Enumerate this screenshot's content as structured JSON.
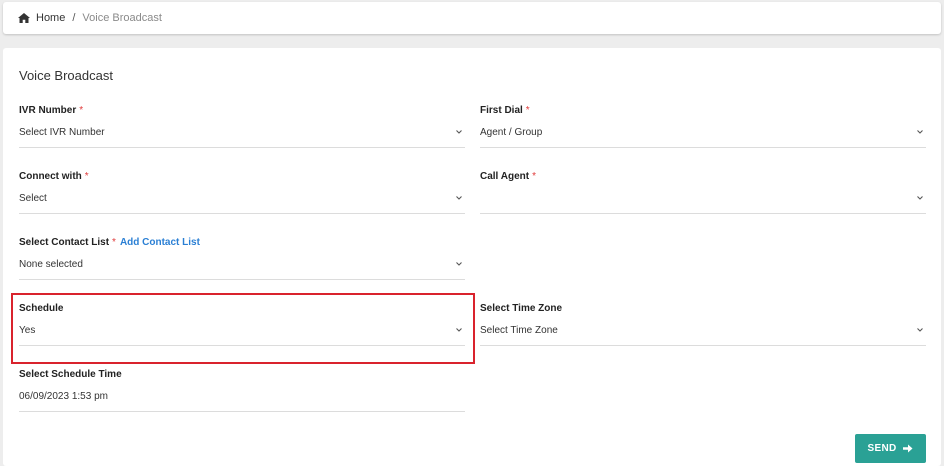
{
  "breadcrumb": {
    "home_label": "Home",
    "separator": "/",
    "current_label": "Voice Broadcast",
    "home_icon": "home-icon"
  },
  "form": {
    "title": "Voice Broadcast",
    "required_marker": "*",
    "ivr_number": {
      "label": "IVR Number",
      "value": "Select IVR Number"
    },
    "first_dial": {
      "label": "First Dial",
      "value": "Agent / Group"
    },
    "connect_with": {
      "label": "Connect with",
      "value": "Select"
    },
    "call_agent": {
      "label": "Call Agent",
      "value": ""
    },
    "contact_list": {
      "label": "Select Contact List",
      "add_link": "Add Contact List",
      "value": "None selected"
    },
    "schedule": {
      "label": "Schedule",
      "value": "Yes"
    },
    "time_zone": {
      "label": "Select Time Zone",
      "value": "Select Time Zone"
    },
    "schedule_time": {
      "label": "Select Schedule Time",
      "value": "06/09/2023 1:53 pm"
    }
  },
  "send_button": {
    "label": "SEND",
    "icon": "arrow-right-icon"
  },
  "colors": {
    "accent": "#2aa195",
    "required": "#e03a3a",
    "link": "#2a7fd4",
    "highlight": "#d9232d"
  }
}
